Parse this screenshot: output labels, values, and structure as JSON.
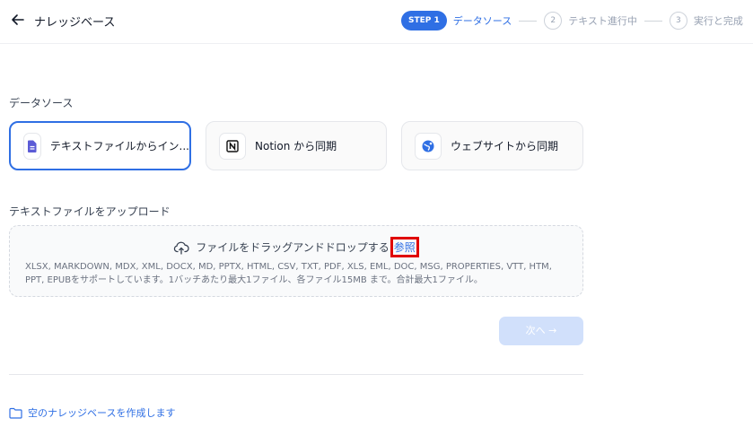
{
  "header": {
    "title": "ナレッジベース",
    "steps": [
      {
        "badge": "STEP 1",
        "label": "データソース"
      },
      {
        "num": "2",
        "label": "テキスト進行中"
      },
      {
        "num": "3",
        "label": "実行と完成"
      }
    ]
  },
  "datasource": {
    "title": "データソース",
    "options": [
      {
        "label": "テキストファイルからイン...",
        "icon": "file-text-icon",
        "selected": true
      },
      {
        "label": "Notion から同期",
        "icon": "notion-icon"
      },
      {
        "label": "ウェブサイトから同期",
        "icon": "web-icon"
      }
    ]
  },
  "upload": {
    "title": "テキストファイルをアップロード",
    "prompt": "ファイルをドラッグアンドドロップする",
    "browse": "参照",
    "description": "XLSX, MARKDOWN, MDX, XML, DOCX, MD, PPTX, HTML, CSV, TXT, PDF, XLS, EML, DOC, MSG, PROPERTIES, VTT, HTM, PPT, EPUBをサポートしています。1バッチあたり最大1ファイル、各ファイル15MB まで。合計最大1ファイル。"
  },
  "next_button": "次へ →",
  "empty_link": "空のナレッジベースを作成します",
  "colors": {
    "accent": "#2f6fe4",
    "highlight_box": "#e00000"
  }
}
